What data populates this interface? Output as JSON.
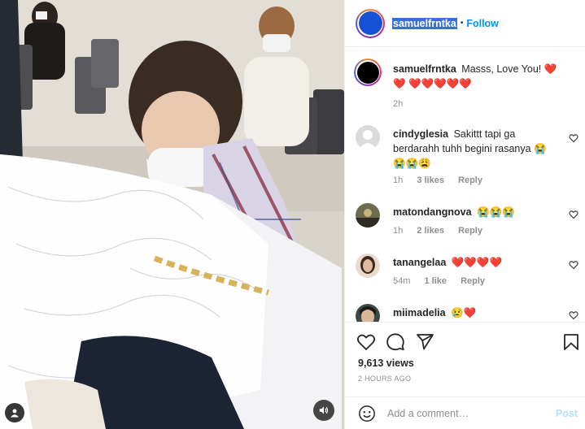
{
  "header": {
    "username": "samuelfrntka",
    "separator": "•",
    "follow_label": "Follow"
  },
  "caption": {
    "username": "samuelfrntka",
    "text": "Masss, Love You! ❤️❤️ ❤️❤️❤️❤️❤️",
    "time": "2h"
  },
  "comments": [
    {
      "username": "cindyglesia",
      "text": "Sakittt tapi ga berdarahh tuhh begini rasanya 😭😭😭😩",
      "time": "1h",
      "likes": "3 likes",
      "reply": "Reply"
    },
    {
      "username": "matondangnova",
      "text": "😭😭😭",
      "time": "1h",
      "likes": "2 likes",
      "reply": "Reply"
    },
    {
      "username": "tanangelaa",
      "text": "❤️❤️❤️❤️",
      "time": "54m",
      "likes": "1 like",
      "reply": "Reply"
    },
    {
      "username": "miimadelia",
      "text": "😢❤️",
      "time": "",
      "likes": "",
      "reply": ""
    }
  ],
  "actions": {
    "views": "9,613 views",
    "posted": "2 HOURS AGO"
  },
  "add_comment": {
    "placeholder": "Add a comment…",
    "post_label": "Post"
  },
  "colors": {
    "link_blue": "#0095f6",
    "post_disabled": "#b2dffc",
    "muted_text": "#8e8e8e",
    "heart_red": "#ed4956"
  }
}
